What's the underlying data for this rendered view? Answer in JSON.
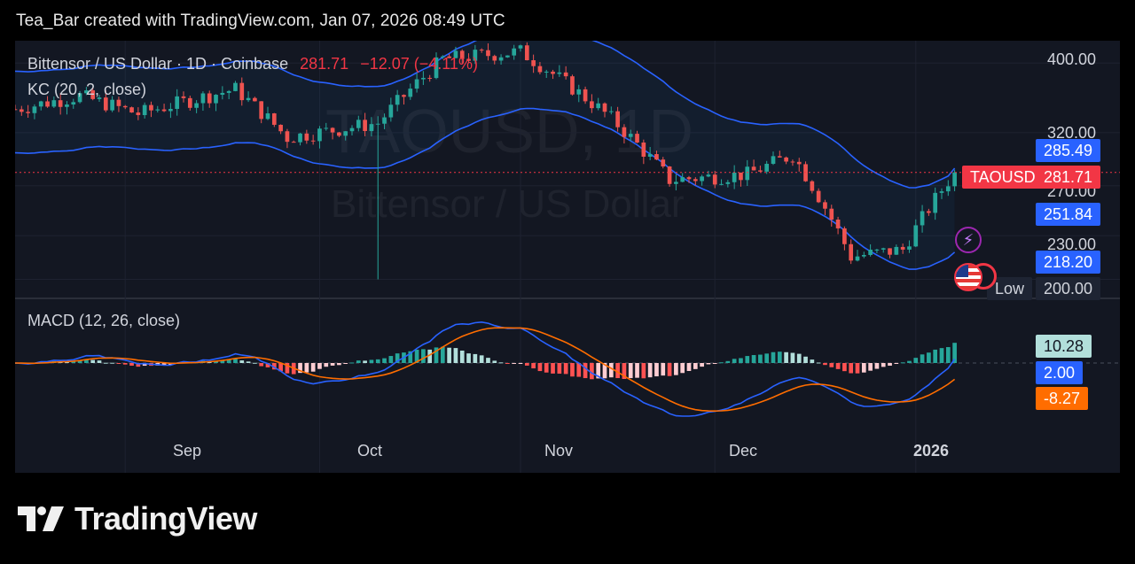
{
  "header": {
    "text": "Tea_Bar created with TradingView.com, Jan 07, 2026 08:49 UTC"
  },
  "legend": {
    "symbol": "Bittensor / US Dollar · 1D · Coinbase",
    "price": "281.71",
    "change": "−12.07 (−4.11%)",
    "indicator": "KC (20, 2, close)",
    "macd": "MACD (12, 26, close)"
  },
  "watermark": {
    "ticker": "TAOUSD, 1D",
    "name": "Bittensor / US Dollar"
  },
  "price_tags": {
    "kc_upper": "285.49",
    "symbol": "TAOUSD",
    "last": "281.71",
    "kc_middle": "251.84",
    "kc_lower": "218.20",
    "low_label": "Low",
    "low_value": "200.00"
  },
  "macd_tags": {
    "histogram": "10.28",
    "macd": "2.00",
    "signal": "-8.27"
  },
  "footer": {
    "brand": "TradingView"
  },
  "colors": {
    "up": "#26a69a",
    "down": "#ef5350",
    "band": "#2962ff",
    "macd_line": "#2962ff",
    "signal_line": "#ff6d00",
    "hist_up_strong": "#26a69a",
    "hist_up_weak": "#b2dfdb",
    "hist_down_strong": "#ff5252",
    "hist_down_weak": "#ffcdd2",
    "background": "#131722",
    "page": "#000000"
  },
  "chart_data": [
    {
      "type": "candlestick",
      "title": "Bittensor / US Dollar · 1D · Coinbase",
      "x_ticks": [
        "Sep",
        "Oct",
        "Nov",
        "Dec",
        "2026"
      ],
      "y_ticks": [
        200.0,
        230.0,
        270.0,
        320.0,
        400.0
      ],
      "y_scale": "log",
      "x_range": [
        "2025-08-15",
        "2026-01-18"
      ],
      "y_range": [
        193,
        420
      ],
      "last_price": 281.71,
      "candles_sample": [
        {
          "date": "2025-08-15",
          "open": 352,
          "high": 360,
          "low": 340,
          "close": 345
        },
        {
          "date": "2025-08-25",
          "open": 370,
          "high": 380,
          "low": 355,
          "close": 360
        },
        {
          "date": "2025-09-03",
          "open": 345,
          "high": 352,
          "low": 335,
          "close": 340
        },
        {
          "date": "2025-09-18",
          "open": 365,
          "high": 372,
          "low": 355,
          "close": 368
        },
        {
          "date": "2025-09-26",
          "open": 320,
          "high": 328,
          "low": 312,
          "close": 315
        },
        {
          "date": "2025-10-10",
          "open": 350,
          "high": 360,
          "low": 200,
          "close": 330
        },
        {
          "date": "2025-10-20",
          "open": 395,
          "high": 420,
          "low": 385,
          "close": 405
        },
        {
          "date": "2025-11-01",
          "open": 405,
          "high": 420,
          "low": 400,
          "close": 415
        },
        {
          "date": "2025-11-15",
          "open": 350,
          "high": 360,
          "low": 330,
          "close": 335
        },
        {
          "date": "2025-11-24",
          "open": 270,
          "high": 280,
          "low": 262,
          "close": 275
        },
        {
          "date": "2025-12-06",
          "open": 285,
          "high": 300,
          "low": 275,
          "close": 280
        },
        {
          "date": "2025-12-13",
          "open": 300,
          "high": 308,
          "low": 292,
          "close": 298
        },
        {
          "date": "2025-12-22",
          "open": 225,
          "high": 235,
          "low": 210,
          "close": 215
        },
        {
          "date": "2025-12-30",
          "open": 222,
          "high": 228,
          "low": 215,
          "close": 220
        },
        {
          "date": "2026-01-07",
          "open": 294,
          "high": 298,
          "low": 279,
          "close": 281.71
        }
      ],
      "keltner_last": {
        "upper": 285.49,
        "middle": 251.84,
        "lower": 218.2
      },
      "low_marker": 200.0
    },
    {
      "type": "line",
      "title": "MACD (12, 26, close)",
      "x_ticks": [
        "Sep",
        "Oct",
        "Nov",
        "Dec",
        "2026"
      ],
      "series": [
        {
          "name": "histogram",
          "last": 10.28
        },
        {
          "name": "MACD",
          "last": 2.0
        },
        {
          "name": "signal",
          "last": -8.27
        }
      ]
    }
  ]
}
